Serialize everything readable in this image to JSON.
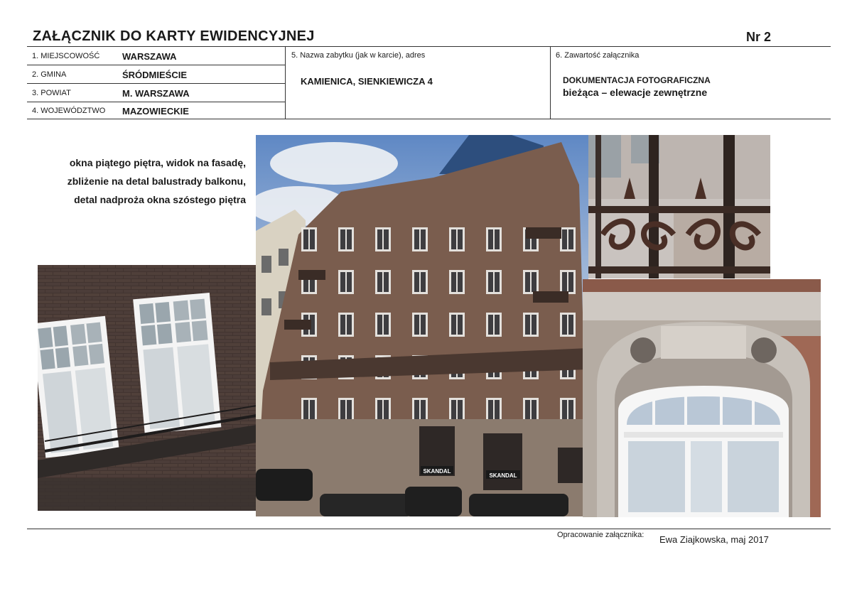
{
  "header": {
    "title": "ZAŁĄCZNIK DO KARTY EWIDENCYJNEJ",
    "number": "Nr 2"
  },
  "location": [
    {
      "label": "1. MIEJSCOWOŚĆ",
      "value": "WARSZAWA"
    },
    {
      "label": "2. GMINA",
      "value": "ŚRÓDMIEŚCIE"
    },
    {
      "label": "3. POWIAT",
      "value": "M. WARSZAWA"
    },
    {
      "label": "4. WOJEWÓDZTWO",
      "value": "MAZOWIECKIE"
    }
  ],
  "monument": {
    "label": "5. Nazwa zabytku (jak w karcie), adres",
    "value": "KAMIENICA, SIENKIEWICZA 4"
  },
  "content": {
    "label": "6. Zawartość załącznika",
    "value_line1": "DOKUMENTACJA FOTOGRAFICZNA",
    "value_line2": "bieżąca – elewacje zewnętrzne"
  },
  "description": [
    "okna piątego  piętra, widok na fasadę,",
    "zbliżenie na detal balustrady balkonu,",
    "detal nadproża okna szóstego piętra"
  ],
  "photos": {
    "shop_sign_1": "SKANDAL",
    "shop_sign_2": "SKANDAL"
  },
  "footer": {
    "prepared_label": "Opracowanie załącznika:",
    "author": "Ewa Ziajkowska, maj 2017"
  }
}
